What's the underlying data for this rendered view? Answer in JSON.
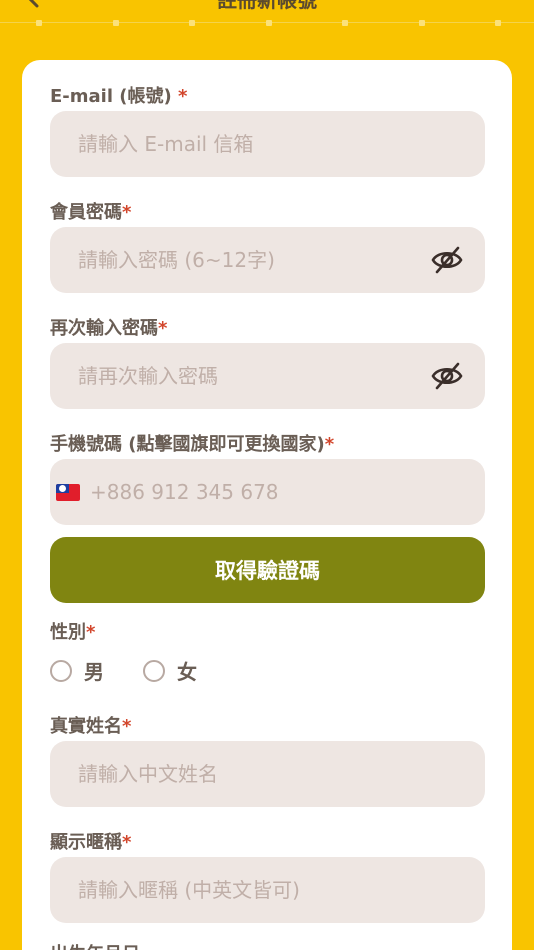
{
  "header": {
    "title": "註冊新帳號"
  },
  "form": {
    "email": {
      "label": "E-mail (帳號)",
      "required": "*",
      "placeholder": "請輸入 E-mail 信箱"
    },
    "password": {
      "label": "會員密碼",
      "required": "*",
      "placeholder": "請輸入密碼 (6~12字)",
      "toggle_icon": "eye-off-icon"
    },
    "confirm_password": {
      "label": "再次輸入密碼",
      "required": "*",
      "placeholder": "請再次輸入密碼",
      "toggle_icon": "eye-off-icon"
    },
    "phone": {
      "label": "手機號碼 (點擊國旗即可更換國家)",
      "required": "*",
      "placeholder": "+886 912 345 678",
      "flag_icon": "taiwan-flag-icon"
    },
    "verify_button_label": "取得驗證碼",
    "gender": {
      "label": "性別",
      "required": "*",
      "options": [
        "男",
        "女"
      ]
    },
    "real_name": {
      "label": "真實姓名",
      "required": "*",
      "placeholder": "請輸入中文姓名"
    },
    "nickname": {
      "label": "顯示暱稱",
      "required": "*",
      "placeholder": "請輸入暱稱 (中英文皆可)"
    },
    "birthday": {
      "label": "出生年月日"
    }
  },
  "colors": {
    "background": "#F9C400",
    "card": "#FFFFFF",
    "field": "#EEE6E2",
    "button": "#808511",
    "required": "#D2462C",
    "label": "#6A5E55"
  }
}
